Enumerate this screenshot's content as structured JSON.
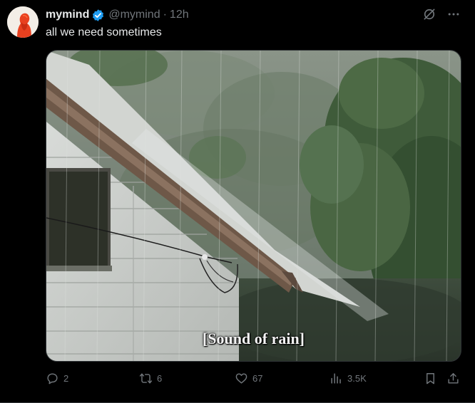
{
  "tweet": {
    "author": {
      "display_name": "mymind",
      "handle": "@mymind",
      "verified": true,
      "avatar_icon": "avatar-orange-figure"
    },
    "separator": "·",
    "time": "12h",
    "text": "all we need sometimes",
    "media": {
      "caption": "[Sound of rain]"
    },
    "header_actions": {
      "grok_icon": "grok-icon",
      "more_icon": "more-icon"
    },
    "stats": {
      "replies": "2",
      "reposts": "6",
      "likes": "67",
      "views": "3.5K"
    }
  },
  "colors": {
    "background": "#000000",
    "text_primary": "#e7e9ea",
    "text_secondary": "#71767b",
    "verified_blue": "#1d9bf0",
    "border": "#2f3336"
  }
}
